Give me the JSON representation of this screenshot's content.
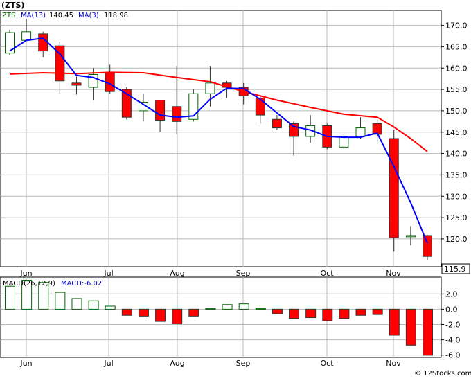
{
  "title": "(ZTS)",
  "watermark": "© 12Stocks.com",
  "colors": {
    "up": "#00aa00",
    "down": "#ff0000",
    "ma13": "#ff0000",
    "ma3": "#0000ff",
    "grid": "#b8b8b8",
    "frame": "#000000",
    "panel_bg": "#ffffff",
    "label_blue": "#0000cc",
    "outer_bg": "#e8e8e8"
  },
  "chart_data": [
    {
      "type": "candlestick",
      "ticker": "ZTS",
      "legend": {
        "ticker_label": "ZTS",
        "ma13_label": "MA(13)",
        "ma13_value": "140.45",
        "ma3_label": "MA(3)",
        "ma3_value": "118.98"
      },
      "last_price_label": "115.9",
      "ylim": [
        113.5,
        173.5
      ],
      "y_ticks": [
        120,
        125,
        130,
        135,
        140,
        145,
        150,
        155,
        160,
        165,
        170
      ],
      "y_tick_labels": [
        "120.0",
        "125.0",
        "130.0",
        "135.0",
        "140.0",
        "145.0",
        "150.0",
        "155.0",
        "160.0",
        "165.0",
        "170.0"
      ],
      "x_labels": [
        "Jun",
        "Jul",
        "Aug",
        "Sep",
        "Oct",
        "Nov"
      ],
      "candles": [
        {
          "o": 163.5,
          "h": 169.0,
          "l": 163.0,
          "c": 168.3
        },
        {
          "o": 166.5,
          "h": 171.5,
          "l": 166.5,
          "c": 168.5
        },
        {
          "o": 168.0,
          "h": 168.5,
          "l": 162.5,
          "c": 164.0
        },
        {
          "o": 165.2,
          "h": 166.2,
          "l": 154.0,
          "c": 157.0
        },
        {
          "o": 156.5,
          "h": 158.0,
          "l": 153.8,
          "c": 156.0
        },
        {
          "o": 155.5,
          "h": 160.0,
          "l": 152.5,
          "c": 158.5
        },
        {
          "o": 159.0,
          "h": 160.8,
          "l": 154.0,
          "c": 154.5
        },
        {
          "o": 155.0,
          "h": 155.5,
          "l": 148.0,
          "c": 148.5
        },
        {
          "o": 150.0,
          "h": 154.0,
          "l": 147.5,
          "c": 152.0
        },
        {
          "o": 152.5,
          "h": 152.5,
          "l": 145.0,
          "c": 147.8
        },
        {
          "o": 151.0,
          "h": 160.5,
          "l": 144.5,
          "c": 147.5
        },
        {
          "o": 148.0,
          "h": 155.0,
          "l": 147.5,
          "c": 154.0
        },
        {
          "o": 154.0,
          "h": 160.5,
          "l": 151.0,
          "c": 156.5
        },
        {
          "o": 156.5,
          "h": 157.0,
          "l": 153.0,
          "c": 155.5
        },
        {
          "o": 155.5,
          "h": 156.5,
          "l": 151.5,
          "c": 153.5
        },
        {
          "o": 153.0,
          "h": 153.5,
          "l": 147.0,
          "c": 149.0
        },
        {
          "o": 148.0,
          "h": 149.0,
          "l": 145.5,
          "c": 146.0
        },
        {
          "o": 147.0,
          "h": 147.5,
          "l": 139.5,
          "c": 144.0
        },
        {
          "o": 144.0,
          "h": 149.0,
          "l": 142.5,
          "c": 146.5
        },
        {
          "o": 146.5,
          "h": 147.0,
          "l": 141.0,
          "c": 141.5
        },
        {
          "o": 141.5,
          "h": 144.5,
          "l": 141.0,
          "c": 144.0
        },
        {
          "o": 144.0,
          "h": 148.5,
          "l": 143.5,
          "c": 146.0
        },
        {
          "o": 147.0,
          "h": 148.0,
          "l": 142.5,
          "c": 144.5
        },
        {
          "o": 143.5,
          "h": 145.5,
          "l": 117.0,
          "c": 120.3
        },
        {
          "o": 120.5,
          "h": 123.0,
          "l": 118.5,
          "c": 120.8
        },
        {
          "o": 120.8,
          "h": 121.0,
          "l": 115.0,
          "c": 115.9
        }
      ],
      "ma13": [
        {
          "i": 0,
          "v": 158.6
        },
        {
          "i": 2,
          "v": 158.9
        },
        {
          "i": 4,
          "v": 158.7
        },
        {
          "i": 6,
          "v": 159.0
        },
        {
          "i": 8,
          "v": 158.9
        },
        {
          "i": 10,
          "v": 157.8
        },
        {
          "i": 12,
          "v": 156.8
        },
        {
          "i": 14,
          "v": 154.5
        },
        {
          "i": 16,
          "v": 152.5
        },
        {
          "i": 18,
          "v": 150.8
        },
        {
          "i": 20,
          "v": 149.2
        },
        {
          "i": 22,
          "v": 148.5
        },
        {
          "i": 23,
          "v": 146.2
        },
        {
          "i": 24,
          "v": 143.5
        },
        {
          "i": 25,
          "v": 140.45
        }
      ],
      "ma3": [
        {
          "i": 0,
          "v": 164.0
        },
        {
          "i": 1,
          "v": 166.5
        },
        {
          "i": 2,
          "v": 167.0
        },
        {
          "i": 3,
          "v": 163.3
        },
        {
          "i": 4,
          "v": 158.3
        },
        {
          "i": 5,
          "v": 157.8
        },
        {
          "i": 6,
          "v": 156.3
        },
        {
          "i": 7,
          "v": 154.0
        },
        {
          "i": 8,
          "v": 151.5
        },
        {
          "i": 9,
          "v": 149.0
        },
        {
          "i": 10,
          "v": 148.5
        },
        {
          "i": 11,
          "v": 148.8
        },
        {
          "i": 12,
          "v": 152.7
        },
        {
          "i": 13,
          "v": 155.3
        },
        {
          "i": 14,
          "v": 155.2
        },
        {
          "i": 15,
          "v": 152.7
        },
        {
          "i": 16,
          "v": 149.5
        },
        {
          "i": 17,
          "v": 146.3
        },
        {
          "i": 18,
          "v": 145.5
        },
        {
          "i": 19,
          "v": 144.0
        },
        {
          "i": 20,
          "v": 143.8
        },
        {
          "i": 21,
          "v": 143.8
        },
        {
          "i": 22,
          "v": 144.8
        },
        {
          "i": 23,
          "v": 136.9
        },
        {
          "i": 24,
          "v": 128.5
        },
        {
          "i": 25,
          "v": 118.98
        }
      ]
    },
    {
      "type": "bar",
      "indicator_label": "MACD(26,12,9)",
      "value_label": "MACD:-6.02",
      "ylim": [
        -6.3,
        4.2
      ],
      "y_ticks": [
        2,
        0,
        -2,
        -4,
        -6
      ],
      "y_tick_labels": [
        "2.0",
        "0.0",
        "-2.0",
        "-4.0",
        "-6.0"
      ],
      "x_labels": [
        "Jun",
        "Jul",
        "Aug",
        "Sep",
        "Oct",
        "Nov"
      ],
      "values": [
        3.0,
        3.8,
        3.5,
        2.2,
        1.4,
        1.1,
        0.4,
        -0.8,
        -0.9,
        -1.6,
        -1.9,
        -0.9,
        0.1,
        0.6,
        0.7,
        0.1,
        -0.6,
        -1.2,
        -1.1,
        -1.5,
        -1.2,
        -0.8,
        -0.7,
        -3.4,
        -4.7,
        -6.02
      ]
    }
  ]
}
